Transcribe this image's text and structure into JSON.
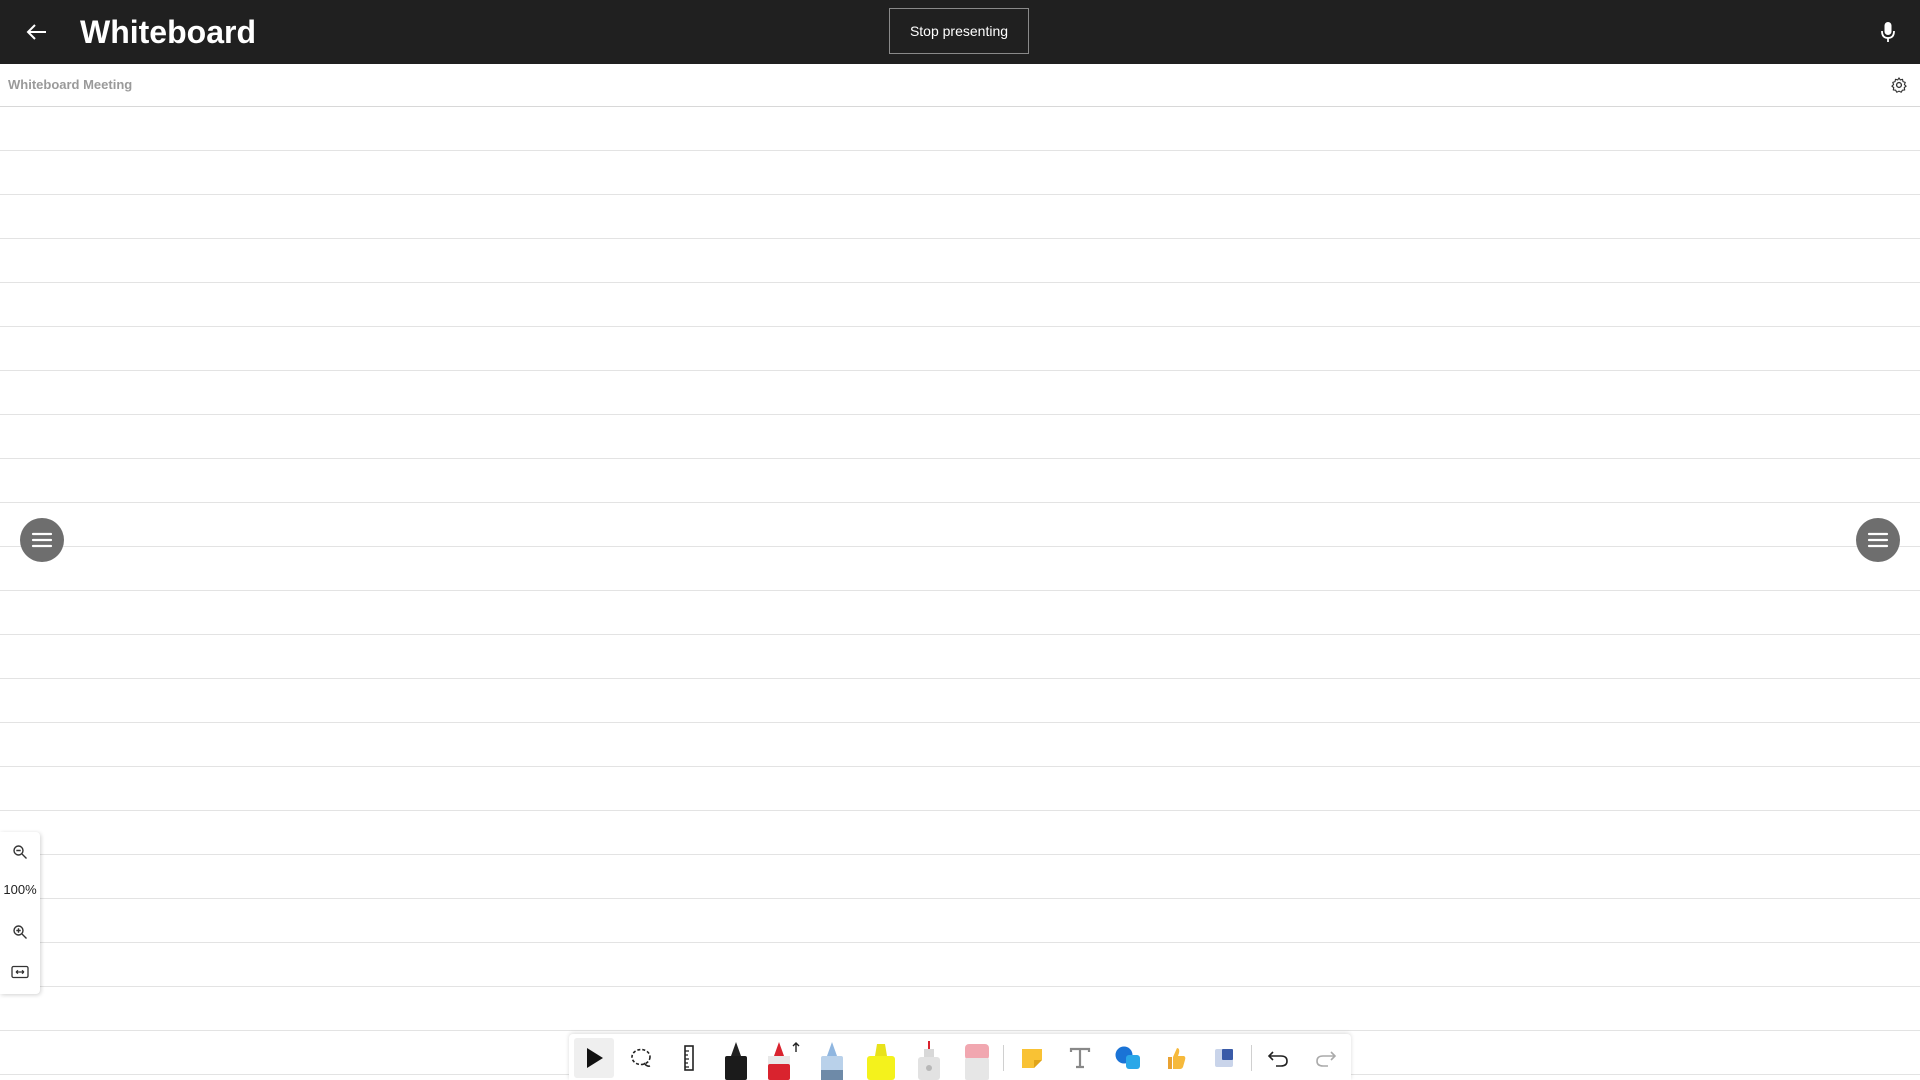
{
  "topbar": {
    "title": "Whiteboard",
    "stop_presenting_label": "Stop presenting",
    "back_icon": "arrow-left-icon",
    "mic_icon": "microphone-icon"
  },
  "subbar": {
    "meeting_name": "Whiteboard Meeting",
    "settings_icon": "gear-icon"
  },
  "zoom": {
    "level": "100%"
  },
  "toolbar": {
    "tools": [
      "select-tool",
      "lasso-tool",
      "ruler-tool",
      "black-pen-tool",
      "red-pen-tool",
      "blue-pen-tool",
      "yellow-highlighter-tool",
      "marker-tool",
      "eraser-tool",
      "sticky-note-tool",
      "text-tool",
      "shapes-tool",
      "reactions-tool",
      "template-tool",
      "undo-button",
      "redo-button"
    ],
    "active_tool": "select-tool"
  },
  "colors": {
    "topbar_bg": "#202020",
    "red_pen": "#d9232e",
    "yellow_highlighter": "#f4f21c",
    "sticky_note": "#f9c234",
    "shapes_blue": "#1a73d6"
  }
}
